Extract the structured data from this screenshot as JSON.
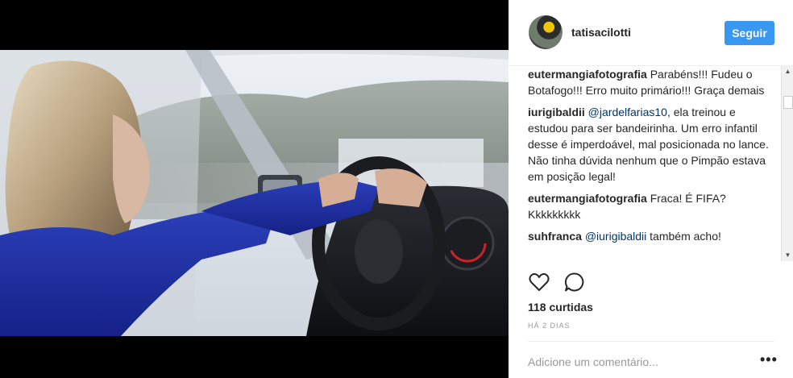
{
  "post": {
    "username": "tatisacilotti",
    "follow_label": "Seguir",
    "comments": [
      {
        "author": "eutermangiafotografia",
        "mention": "",
        "text": "Parabéns!!! Fudeu o Botafogo!!! Erro muito primário!!! Graça demais"
      },
      {
        "author": "iurigibaldii",
        "mention": "@jardelfarias10",
        "text": ", ela treinou e estudou para ser bandeirinha. Um erro infantil desse é imperdoável, mal posicionada no lance. Não tinha dúvida nenhum que o Pimpão estava em posição legal!"
      },
      {
        "author": "eutermangiafotografia",
        "mention": "",
        "text": "Fraca! É FIFA? Kkkkkkkkk"
      },
      {
        "author": "suhfranca",
        "mention": "@iurigibaldii",
        "text": "também acho!"
      }
    ],
    "likes": "118 curtidas",
    "time": "HÁ 2 DIAS",
    "add_comment_placeholder": "Adicione um comentário...",
    "more_options": "•••"
  },
  "icons": {
    "like": "heart-icon",
    "comment": "speech-bubble-icon"
  },
  "colors": {
    "accent": "#3897f0",
    "text": "#262626",
    "muted": "#999999",
    "mention": "#003569"
  }
}
